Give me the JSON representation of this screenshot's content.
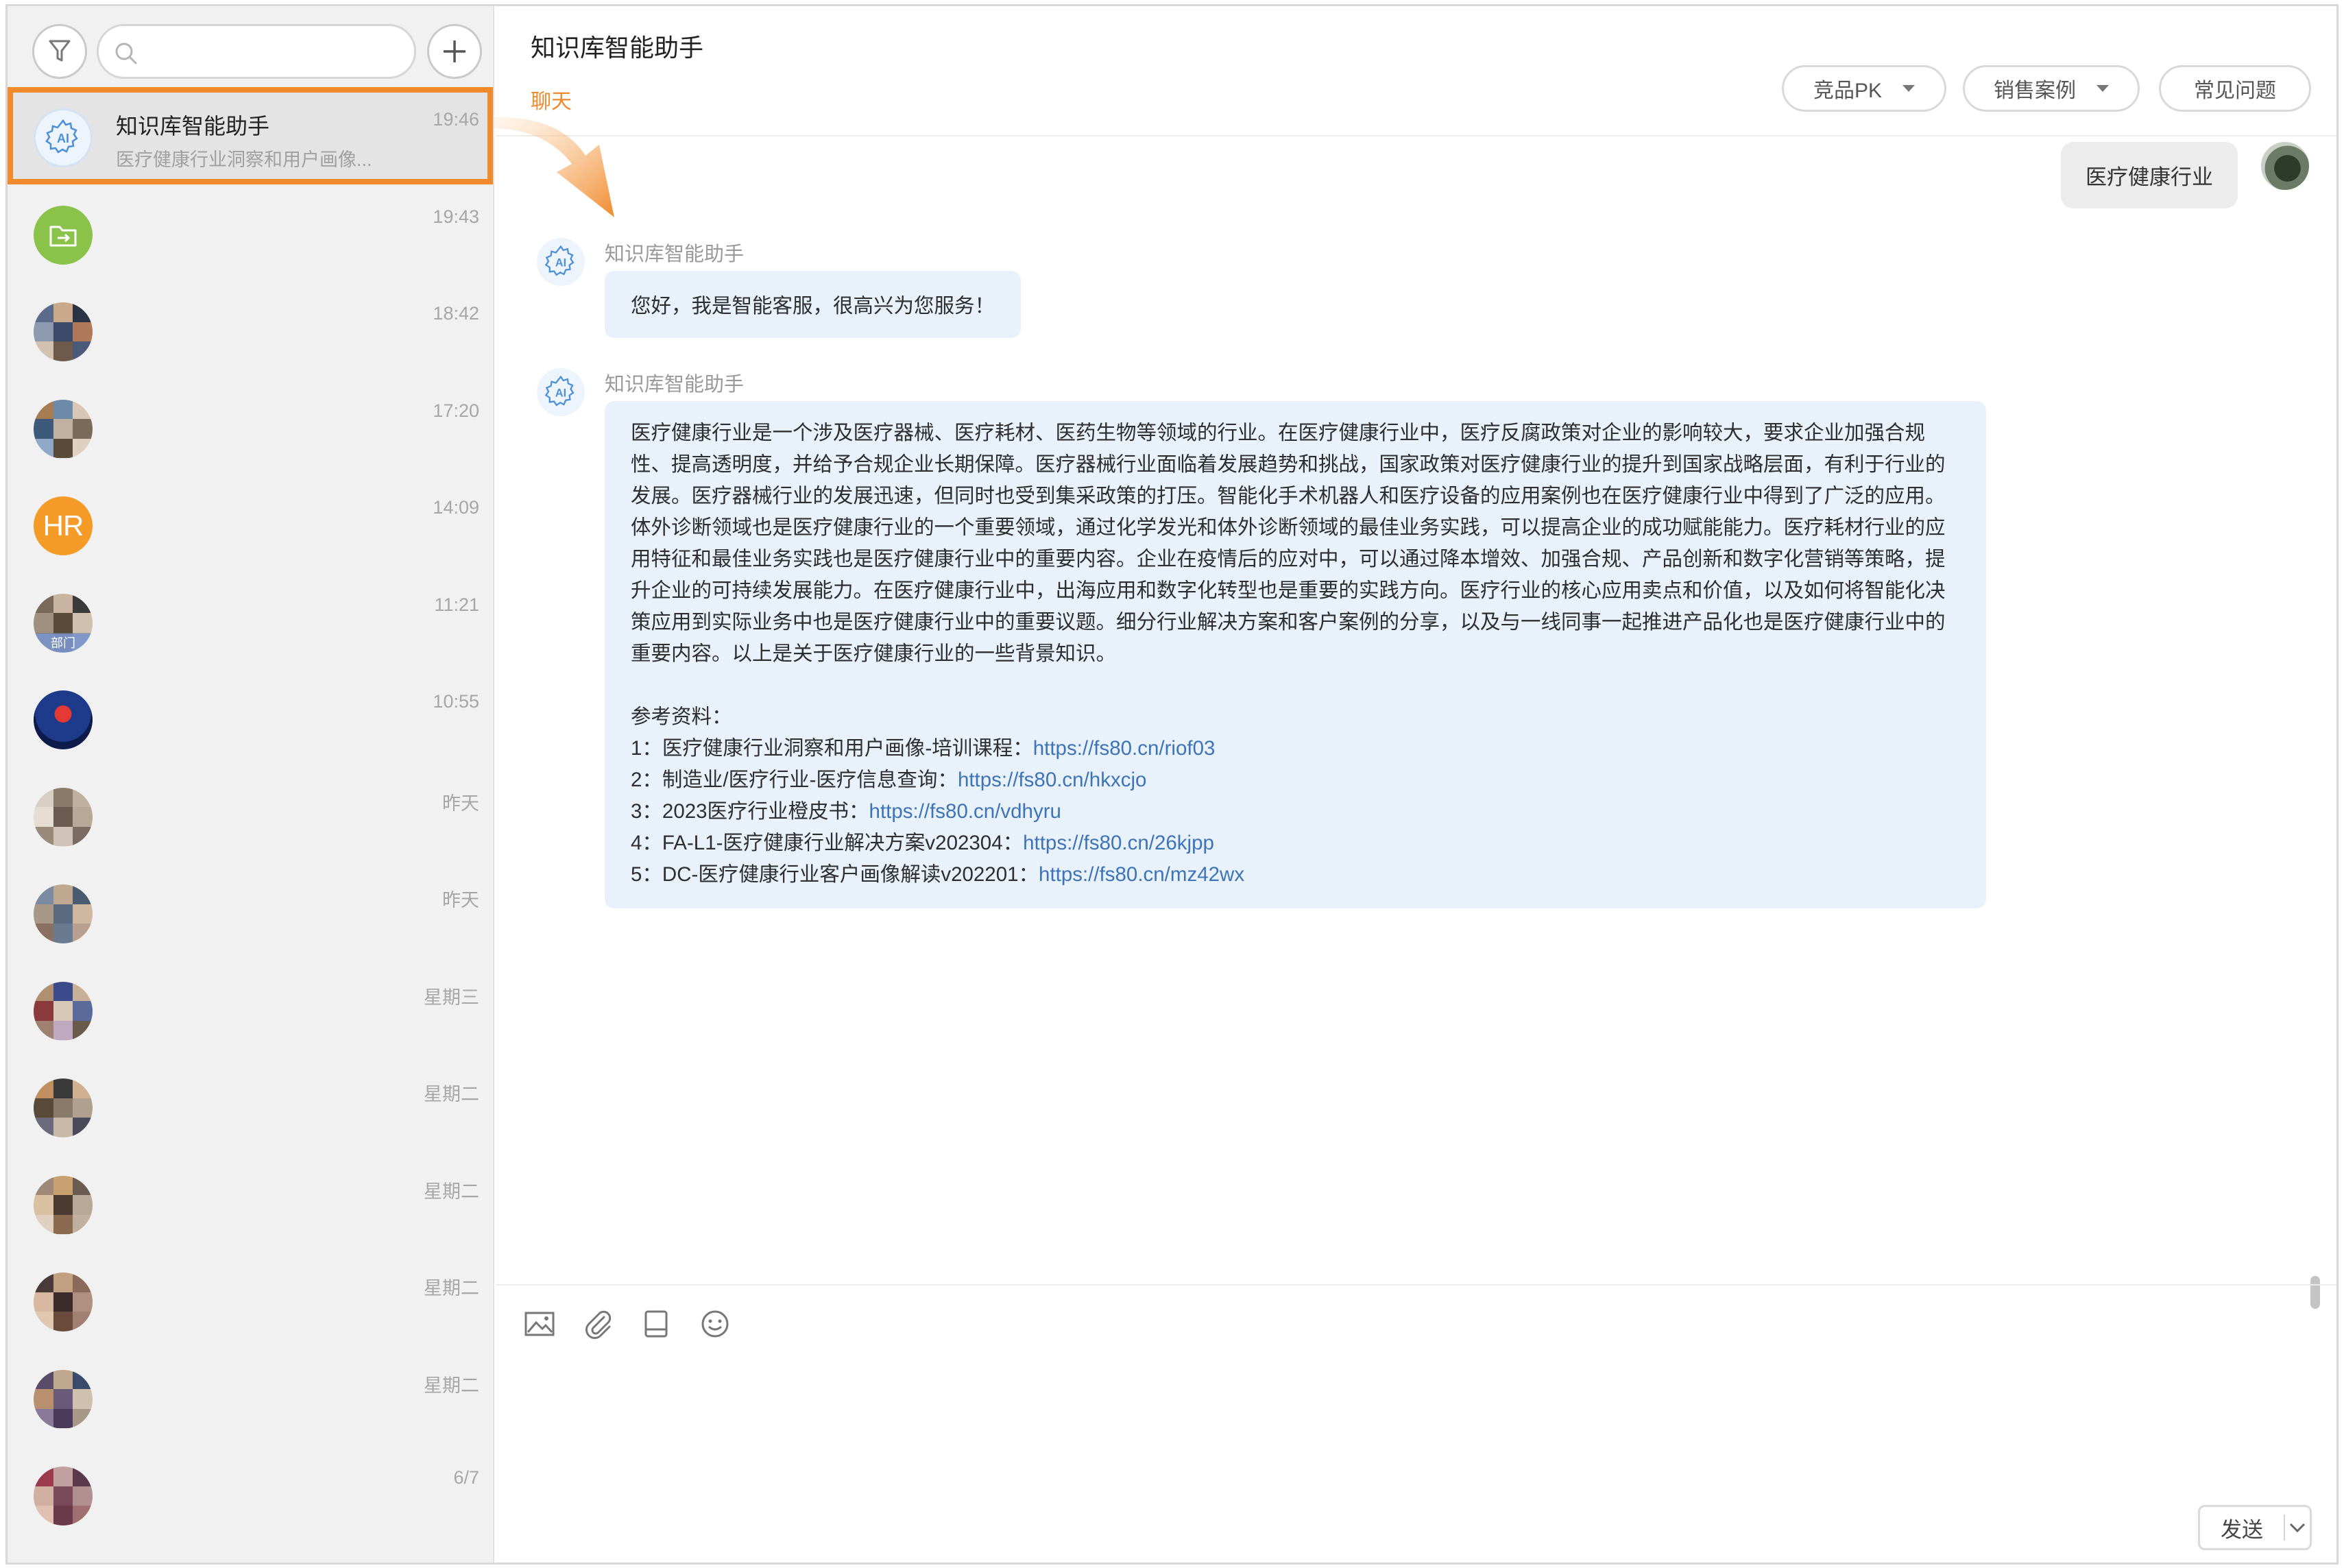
{
  "search": {
    "placeholder": ""
  },
  "conversations": [
    {
      "title": "知识库智能助手",
      "subtitle": "医疗健康行业洞察和用户画像...",
      "time": "19:46",
      "avatar": "ai-bot-icon",
      "active": true
    },
    {
      "title": "",
      "subtitle": "",
      "time": "19:43",
      "avatar": "folder-icon"
    },
    {
      "title": "",
      "subtitle": "",
      "time": "18:42",
      "avatar": "group-avatar"
    },
    {
      "title": "",
      "subtitle": "",
      "time": "17:20",
      "avatar": "group-avatar"
    },
    {
      "title": "",
      "subtitle": "",
      "time": "14:09",
      "avatar": "hr-avatar",
      "avatar_text": "HR"
    },
    {
      "title": "",
      "subtitle": "",
      "time": "11:21",
      "avatar": "group-avatar",
      "badge": "部门"
    },
    {
      "title": "",
      "subtitle": "",
      "time": "10:55",
      "avatar": "single-avatar"
    },
    {
      "title": "",
      "subtitle": "",
      "time": "昨天",
      "avatar": "group-avatar"
    },
    {
      "title": "",
      "subtitle": "",
      "time": "昨天",
      "avatar": "group-avatar"
    },
    {
      "title": "",
      "subtitle": "",
      "time": "星期三",
      "avatar": "group-avatar"
    },
    {
      "title": "",
      "subtitle": "",
      "time": "星期二",
      "avatar": "group-avatar"
    },
    {
      "title": "",
      "subtitle": "",
      "time": "星期二",
      "avatar": "group-avatar"
    },
    {
      "title": "",
      "subtitle": "",
      "time": "星期二",
      "avatar": "group-avatar"
    },
    {
      "title": "",
      "subtitle": "",
      "time": "星期二",
      "avatar": "group-avatar"
    },
    {
      "title": "",
      "subtitle": "",
      "time": "6/7",
      "avatar": "group-avatar"
    }
  ],
  "header": {
    "title": "知识库智能助手",
    "tab": "聊天",
    "buttons": {
      "compete": "竞品PK",
      "cases": "销售案例",
      "faq": "常见问题"
    }
  },
  "messages": {
    "user_message": "医疗健康行业",
    "bot_name": "知识库智能助手",
    "greeting": "您好，我是智能客服，很高兴为您服务！",
    "answer_paragraph": "医疗健康行业是一个涉及医疗器械、医疗耗材、医药生物等领域的行业。在医疗健康行业中，医疗反腐政策对企业的影响较大，要求企业加强合规性、提高透明度，并给予合规企业长期保障。医疗器械行业面临着发展趋势和挑战，国家政策对医疗健康行业的提升到国家战略层面，有利于行业的发展。医疗器械行业的发展迅速，但同时也受到集采政策的打压。智能化手术机器人和医疗设备的应用案例也在医疗健康行业中得到了广泛的应用。体外诊断领域也是医疗健康行业的一个重要领域，通过化学发光和体外诊断领域的最佳业务实践，可以提高企业的成功赋能能力。医疗耗材行业的应用特征和最佳业务实践也是医疗健康行业中的重要内容。企业在疫情后的应对中，可以通过降本增效、加强合规、产品创新和数字化营销等策略，提升企业的可持续发展能力。在医疗健康行业中，出海应用和数字化转型也是重要的实践方向。医疗行业的核心应用卖点和价值，以及如何将智能化决策应用到实际业务中也是医疗健康行业中的重要议题。细分行业解决方案和客户案例的分享，以及与一线同事一起推进产品化也是医疗健康行业中的重要内容。以上是关于医疗健康行业的一些背景知识。",
    "refs_title": "参考资料：",
    "refs": [
      {
        "label": "1：医疗健康行业洞察和用户画像-培训课程：",
        "url": "https://fs80.cn/riof03"
      },
      {
        "label": "2：制造业/医疗行业-医疗信息查询：",
        "url": "https://fs80.cn/hkxcjo"
      },
      {
        "label": "3：2023医疗行业橙皮书：",
        "url": "https://fs80.cn/vdhyru"
      },
      {
        "label": "4：FA-L1-医疗健康行业解决方案v202304：",
        "url": "https://fs80.cn/26kjpp"
      },
      {
        "label": "5：DC-医疗健康行业客户画像解读v202201：",
        "url": "https://fs80.cn/mz42wx"
      }
    ]
  },
  "composer": {
    "tools": [
      "image-icon",
      "attachment-icon",
      "disk-icon",
      "emoji-icon"
    ],
    "send_label": "发送"
  },
  "colors": {
    "accent": "#f08a2c",
    "link": "#3d74b8",
    "bubble": "#e9f1fb"
  }
}
